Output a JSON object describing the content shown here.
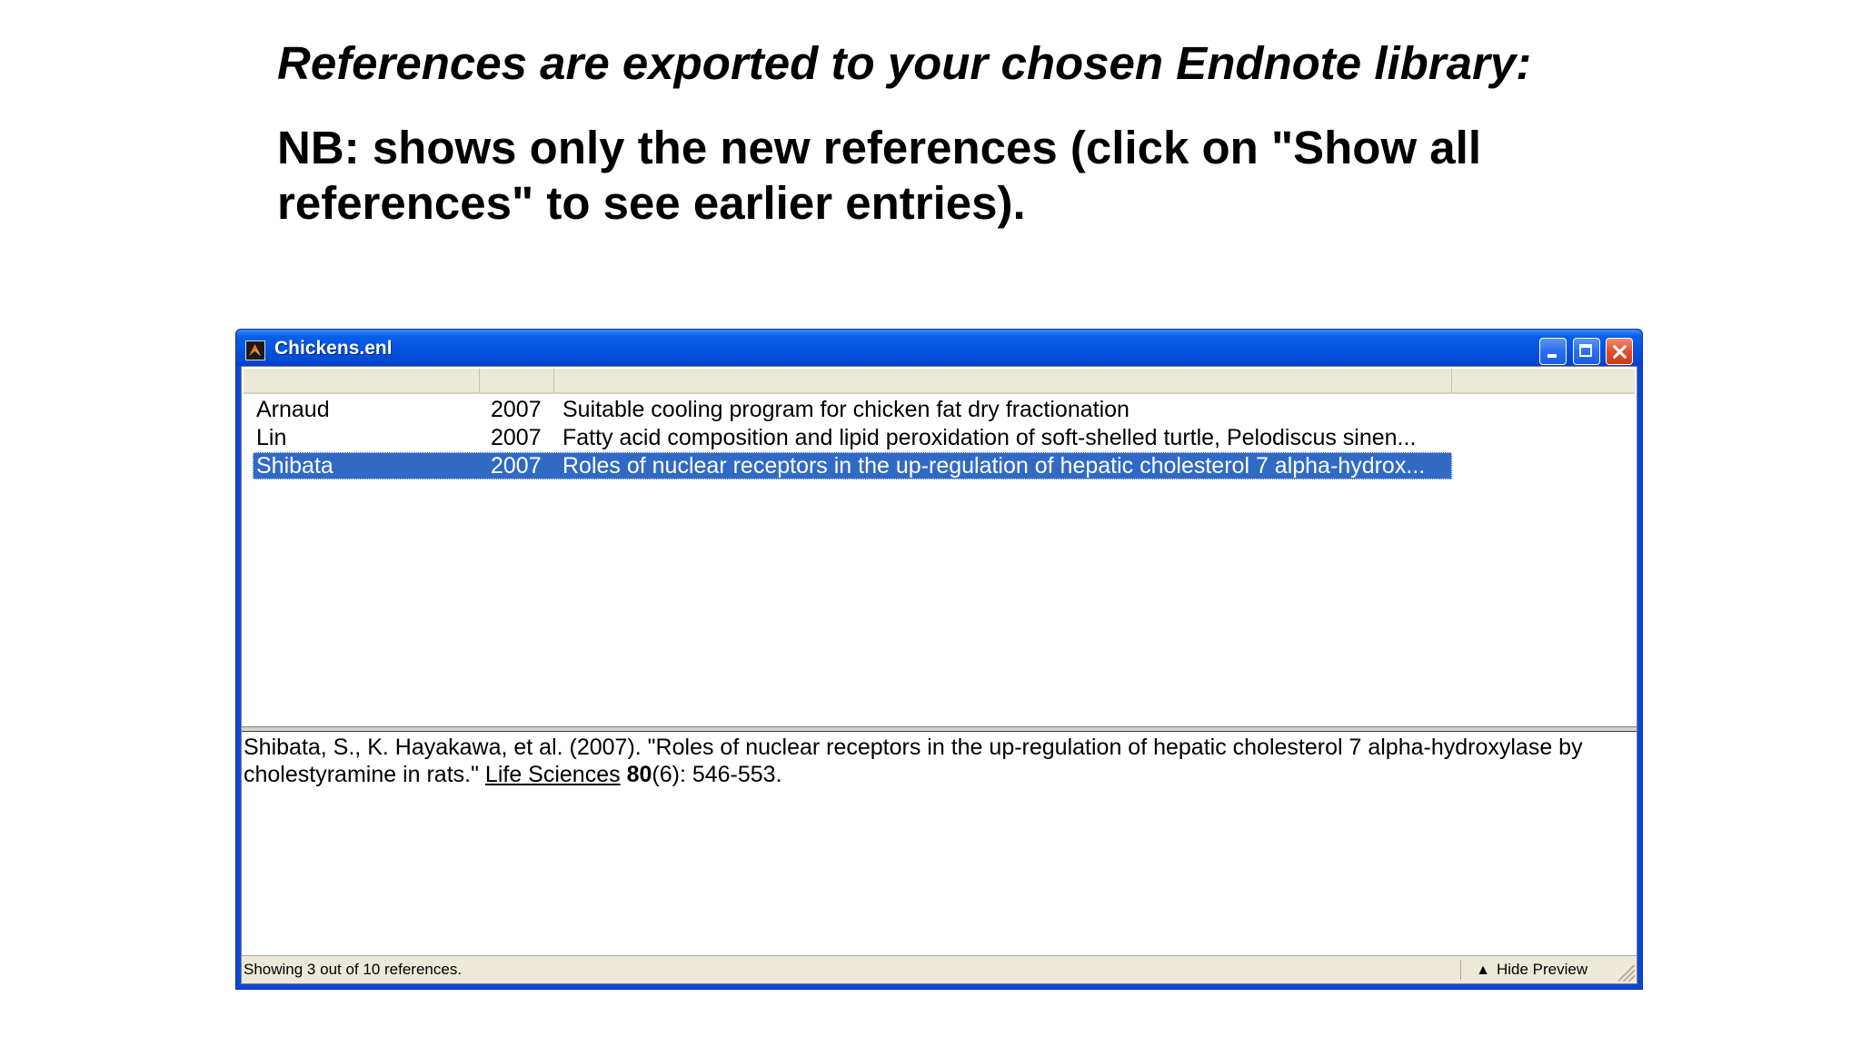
{
  "slide": {
    "heading": "References are exported to your chosen Endnote library:",
    "note": "NB: shows only the new references (click on \"Show all references\" to see earlier entries)."
  },
  "window": {
    "title": "Chickens.enl",
    "icon": "endnote-app-icon",
    "controls": [
      "minimize-icon",
      "maximize-icon",
      "close-icon"
    ]
  },
  "columns": [
    "",
    "",
    ""
  ],
  "references": [
    {
      "author": "Arnaud",
      "year": "2007",
      "title": "Suitable cooling program for chicken fat dry fractionation",
      "selected": false
    },
    {
      "author": "Lin",
      "year": "2007",
      "title": "Fatty acid composition and lipid peroxidation of soft-shelled turtle, Pelodiscus sinen...",
      "selected": false
    },
    {
      "author": "Shibata",
      "year": "2007",
      "title": "Roles of nuclear receptors in the up-regulation of hepatic cholesterol 7 alpha-hydrox...",
      "selected": true
    }
  ],
  "preview": {
    "citation_main": "Shibata, S., K. Hayakawa, et al. (2007). \"Roles of nuclear receptors in the up-regulation of hepatic cholesterol 7 alpha-hydroxylase by cholestyramine in rats.\" ",
    "journal": "Life Sciences",
    "volume": "80",
    "pages": "(6): 546-553."
  },
  "status": {
    "text": "Showing 3 out of 10 references.",
    "hide_preview_label": "Hide Preview",
    "hide_preview_icon": "double-up-arrow-icon"
  },
  "colors": {
    "titlebar": "#0455e0",
    "selection": "#316ac5",
    "close_button": "#e0532d"
  }
}
